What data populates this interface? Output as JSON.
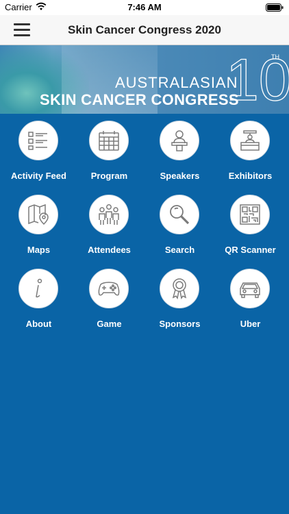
{
  "status": {
    "carrier": "Carrier",
    "time": "7:46 AM"
  },
  "nav": {
    "title": "Skin Cancer Congress 2020"
  },
  "banner": {
    "line1": "AUSTRALASIAN",
    "line2": "SKIN CANCER CONGRESS",
    "number": "10",
    "superscript": "TH"
  },
  "tiles": [
    {
      "label": "Activity Feed",
      "icon": "activity-feed-icon"
    },
    {
      "label": "Program",
      "icon": "calendar-icon"
    },
    {
      "label": "Speakers",
      "icon": "speaker-podium-icon"
    },
    {
      "label": "Exhibitors",
      "icon": "exhibitor-booth-icon"
    },
    {
      "label": "Maps",
      "icon": "map-pin-icon"
    },
    {
      "label": "Attendees",
      "icon": "people-icon"
    },
    {
      "label": "Search",
      "icon": "magnifier-icon"
    },
    {
      "label": "QR Scanner",
      "icon": "qr-code-icon"
    },
    {
      "label": "About",
      "icon": "info-icon"
    },
    {
      "label": "Game",
      "icon": "gamepad-icon"
    },
    {
      "label": "Sponsors",
      "icon": "award-ribbon-icon"
    },
    {
      "label": "Uber",
      "icon": "car-icon"
    }
  ],
  "colors": {
    "background": "#0a64a6",
    "icon_stroke": "#7a7a7a"
  }
}
